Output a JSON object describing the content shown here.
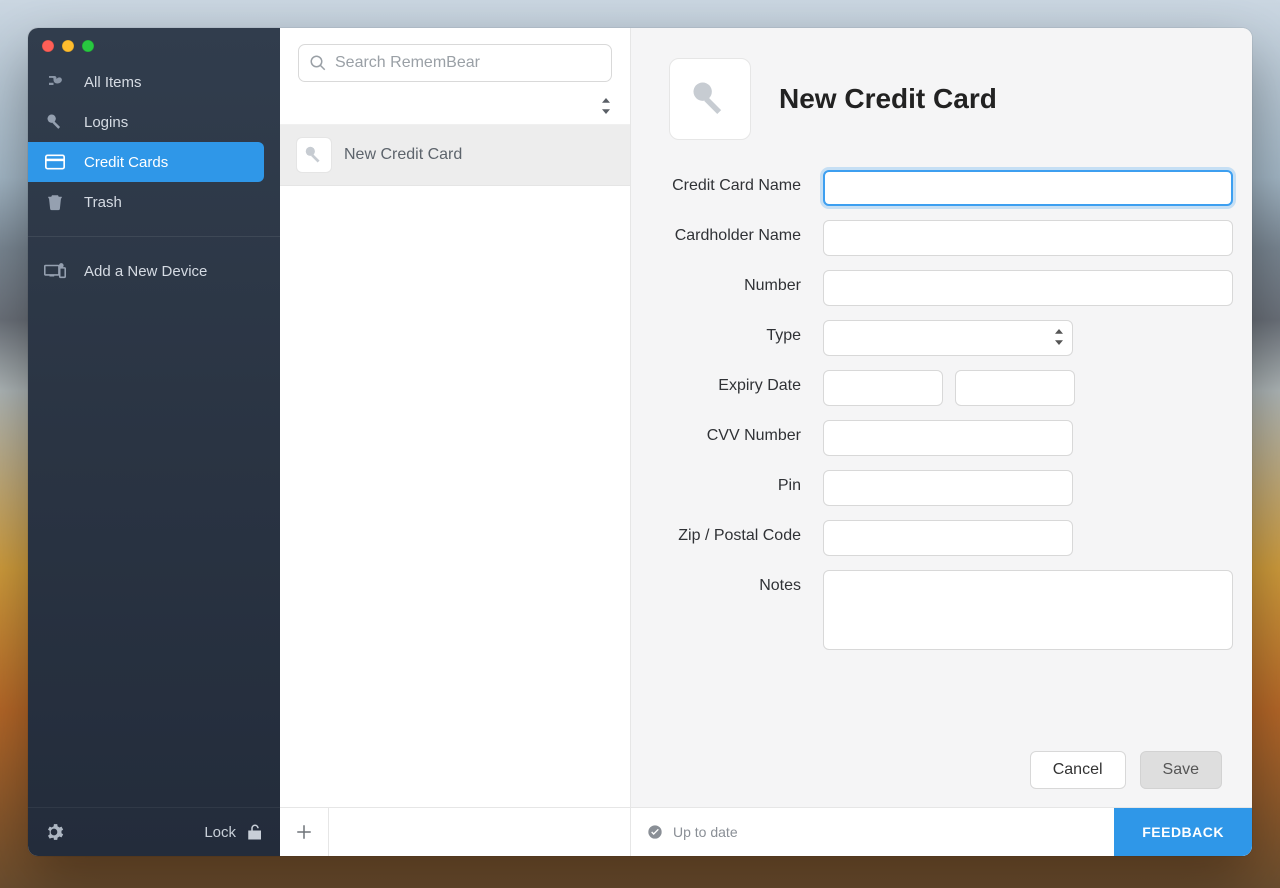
{
  "sidebar": {
    "items": [
      {
        "label": "All Items"
      },
      {
        "label": "Logins"
      },
      {
        "label": "Credit Cards"
      },
      {
        "label": "Trash"
      }
    ],
    "addDeviceLabel": "Add a New Device",
    "lockLabel": "Lock"
  },
  "search": {
    "placeholder": "Search RememBear"
  },
  "list": {
    "items": [
      {
        "title": "New Credit Card"
      }
    ]
  },
  "detail": {
    "title": "New Credit Card",
    "labels": {
      "creditCardName": "Credit Card Name",
      "cardholderName": "Cardholder Name",
      "number": "Number",
      "type": "Type",
      "expiryDate": "Expiry Date",
      "cvvNumber": "CVV Number",
      "pin": "Pin",
      "zip": "Zip / Postal Code",
      "notes": "Notes"
    },
    "values": {
      "creditCardName": "",
      "cardholderName": "",
      "number": "",
      "type": "",
      "expiryMonth": "",
      "expiryYear": "",
      "cvvNumber": "",
      "pin": "",
      "zip": "",
      "notes": ""
    },
    "actions": {
      "cancel": "Cancel",
      "save": "Save"
    }
  },
  "footer": {
    "status": "Up to date",
    "feedback": "FEEDBACK"
  }
}
